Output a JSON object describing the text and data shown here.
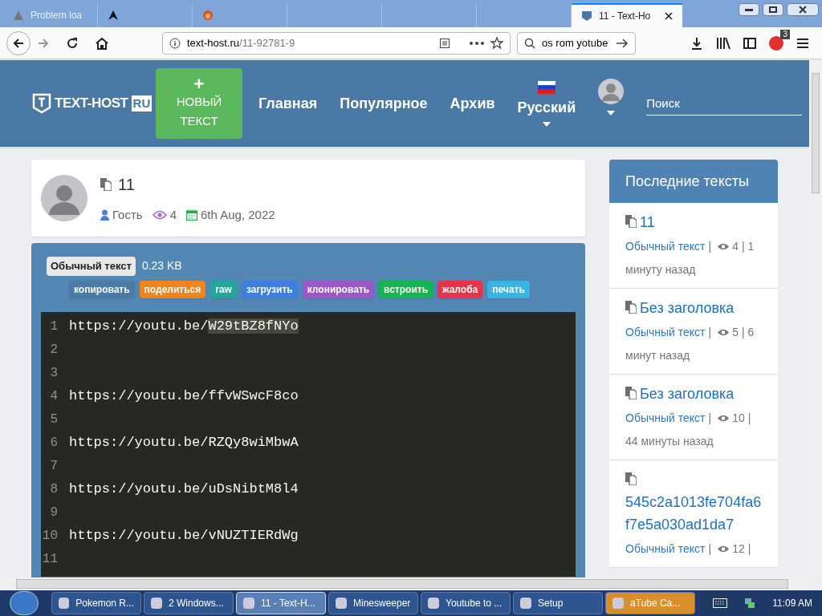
{
  "browser": {
    "tabs": [
      {
        "title": "Problem loa",
        "selected": false
      },
      {
        "selected": false
      },
      {
        "selected": false
      },
      {
        "selected": false
      },
      {
        "selected": false
      },
      {
        "selected": false
      },
      {
        "title": "11 - Text-Ho",
        "selected": true
      }
    ],
    "url_host": "text-host.ru",
    "url_path": "/11-92781-9",
    "search_value": "os rom yotube",
    "addon_badge": "3"
  },
  "header": {
    "logo_main": "TEXT-HOST",
    "logo_suffix": "RU",
    "new_button_plus": "+",
    "new_button": "НОВЫЙ ТЕКСТ",
    "nav": [
      "Главная",
      "Популярное",
      "Архив"
    ],
    "language": "Русский",
    "search_placeholder": "Поиск"
  },
  "paste": {
    "title": "11",
    "author": "Гость",
    "views": "4",
    "date": "6th Aug, 2022",
    "type": "Обычный текст",
    "size": "0.23 KB",
    "actions": [
      {
        "label": "копировать",
        "color": "#4b7aa6"
      },
      {
        "label": "поделиться",
        "color": "#f0851c"
      },
      {
        "label": "raw",
        "color": "#26a69a"
      },
      {
        "label": "загрузить",
        "color": "#3d7fe0"
      },
      {
        "label": "клонировать",
        "color": "#9b59c8"
      },
      {
        "label": "встроить",
        "color": "#16b553"
      },
      {
        "label": "жалоба",
        "color": "#e8334a"
      },
      {
        "label": "печать",
        "color": "#38b5e6"
      }
    ],
    "lines": [
      {
        "number": "1",
        "text": "https://youtu.be/",
        "highlight": "W29tBZ8fNYo"
      },
      {
        "number": "2"
      },
      {
        "number": "3"
      },
      {
        "number": "4",
        "text": "https://youtu.be/ffvWSwcF8co"
      },
      {
        "number": "5"
      },
      {
        "number": "6",
        "text": "https://youtu.be/RZQy8wiMbwA"
      },
      {
        "number": "7"
      },
      {
        "number": "8",
        "text": "https://youtu.be/uDsNibtM8l4"
      },
      {
        "number": "9"
      },
      {
        "number": "10",
        "text": "https://youtu.be/vNUZTIERdWg"
      },
      {
        "number": "11"
      }
    ]
  },
  "sidebar": {
    "title": "Последние тексты",
    "items": [
      {
        "title": "11",
        "type": "Обычный текст",
        "separators": [
          "|",
          "|"
        ],
        "views": "4",
        "age_a": "1",
        "age_b": "минуту назад"
      },
      {
        "title": "Без заголовка",
        "type": "Обычный текст",
        "separators": [
          "|",
          "|"
        ],
        "views": "5",
        "age_a": "6",
        "age_b": "минут назад"
      },
      {
        "title": "Без заголовка",
        "type": "Обычный текст",
        "separators": [
          "|",
          "|"
        ],
        "views": "10",
        "age_b": "44 минуты назад"
      },
      {
        "title": "545c2a1013fe704fa6f7e5a030ad1da7",
        "type": "Обычный текст",
        "separators": [
          "|",
          "|"
        ],
        "views": "12"
      }
    ]
  },
  "taskbar": {
    "items": [
      {
        "label": "Pokemon R...",
        "selected": false,
        "highlight": false
      },
      {
        "label": "2 Windows...",
        "selected": false,
        "highlight": false
      },
      {
        "label": "11 - Text-H...",
        "selected": true,
        "highlight": false
      },
      {
        "label": "Minesweeper",
        "selected": false,
        "highlight": false
      },
      {
        "label": "Youtube to ...",
        "selected": false,
        "highlight": false
      },
      {
        "label": "Setup",
        "selected": false,
        "highlight": false
      },
      {
        "label": "aTube Ca...",
        "selected": false,
        "highlight": true
      }
    ],
    "time": "11:09 AM"
  }
}
